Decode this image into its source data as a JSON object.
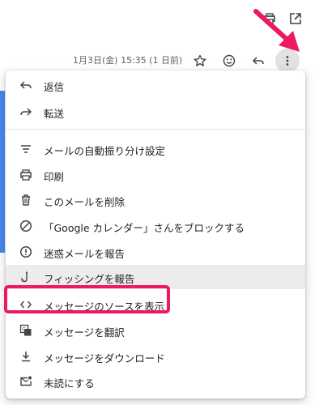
{
  "header": {
    "timestamp": "1月3日(金) 15:35 (1 日前)"
  },
  "icons": {
    "print_all": "print-all-icon",
    "open_new_window": "open-in-new-window-icon",
    "star": "star-icon",
    "emoji": "emoji-icon",
    "reply": "reply-icon",
    "more": "more-vert-icon"
  },
  "menu": {
    "items": [
      {
        "label": "返信",
        "icon": "reply-icon"
      },
      {
        "label": "転送",
        "icon": "forward-icon"
      },
      {
        "label": "メールの自動振り分け設定",
        "icon": "filter-icon"
      },
      {
        "label": "印刷",
        "icon": "print-icon"
      },
      {
        "label": "このメールを削除",
        "icon": "trash-icon"
      },
      {
        "label": "「Google カレンダー」さんをブロックする",
        "icon": "block-icon"
      },
      {
        "label": "迷惑メールを報告",
        "icon": "spam-icon"
      },
      {
        "label": "フィッシングを報告",
        "icon": "phishing-hook-icon"
      },
      {
        "label": "メッセージのソースを表示",
        "icon": "code-icon"
      },
      {
        "label": "メッセージを翻訳",
        "icon": "translate-icon"
      },
      {
        "label": "メッセージをダウンロード",
        "icon": "download-icon"
      },
      {
        "label": "未読にする",
        "icon": "mark-unread-icon"
      }
    ]
  },
  "colors": {
    "highlight": "#ec1a63",
    "arrow": "#ec1a63",
    "accent_blue": "#4285f4",
    "hover_bg": "#ececec"
  }
}
